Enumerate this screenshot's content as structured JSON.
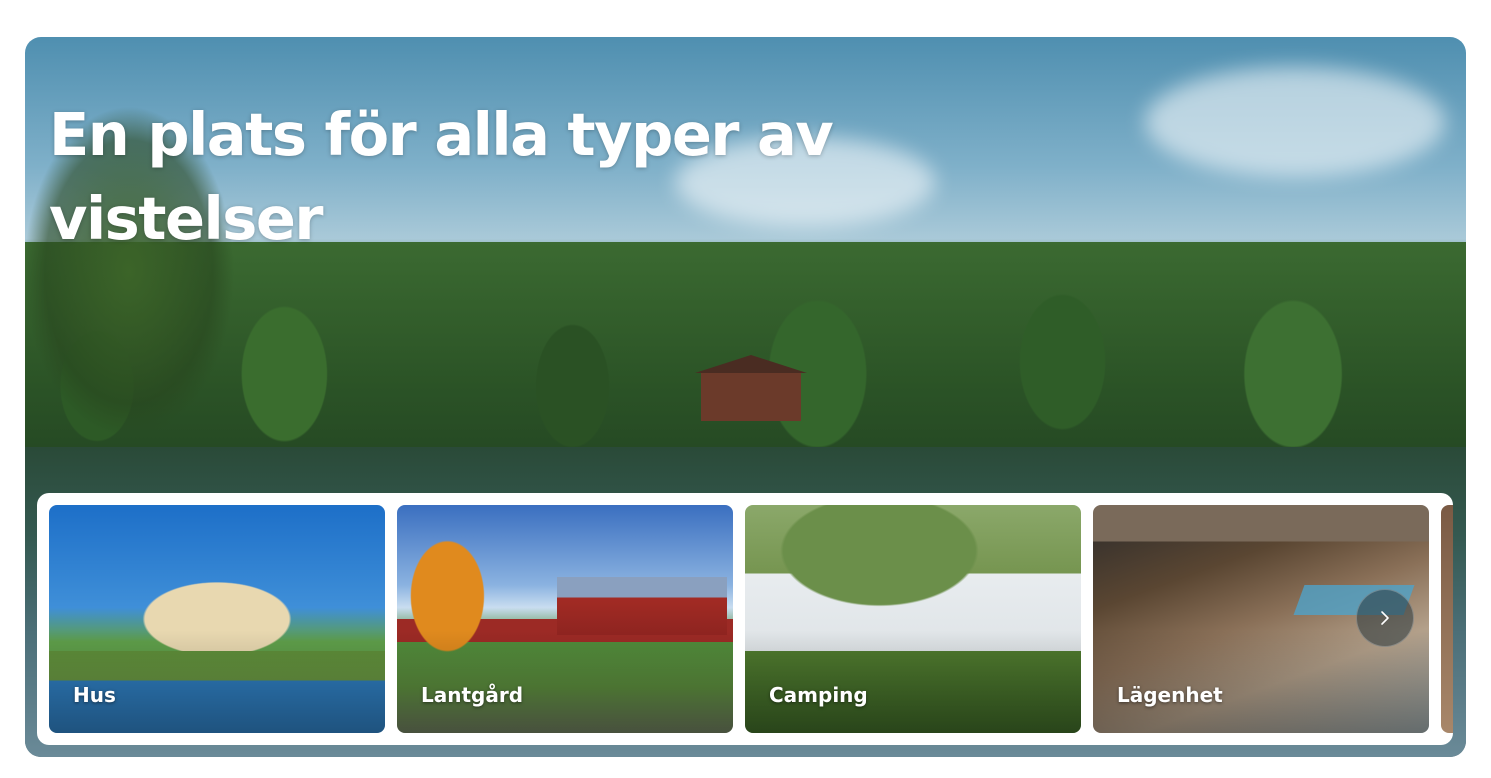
{
  "hero": {
    "title_line1": "En plats för alla typer av",
    "title_line2": "vistelser"
  },
  "categories": [
    {
      "label": "Hus"
    },
    {
      "label": "Lantgård"
    },
    {
      "label": "Camping"
    },
    {
      "label": "Lägenhet"
    }
  ],
  "carousel": {
    "next_icon": "chevron-right-icon"
  },
  "colors": {
    "text_on_image": "#ffffff",
    "strip_background": "#ffffff"
  }
}
